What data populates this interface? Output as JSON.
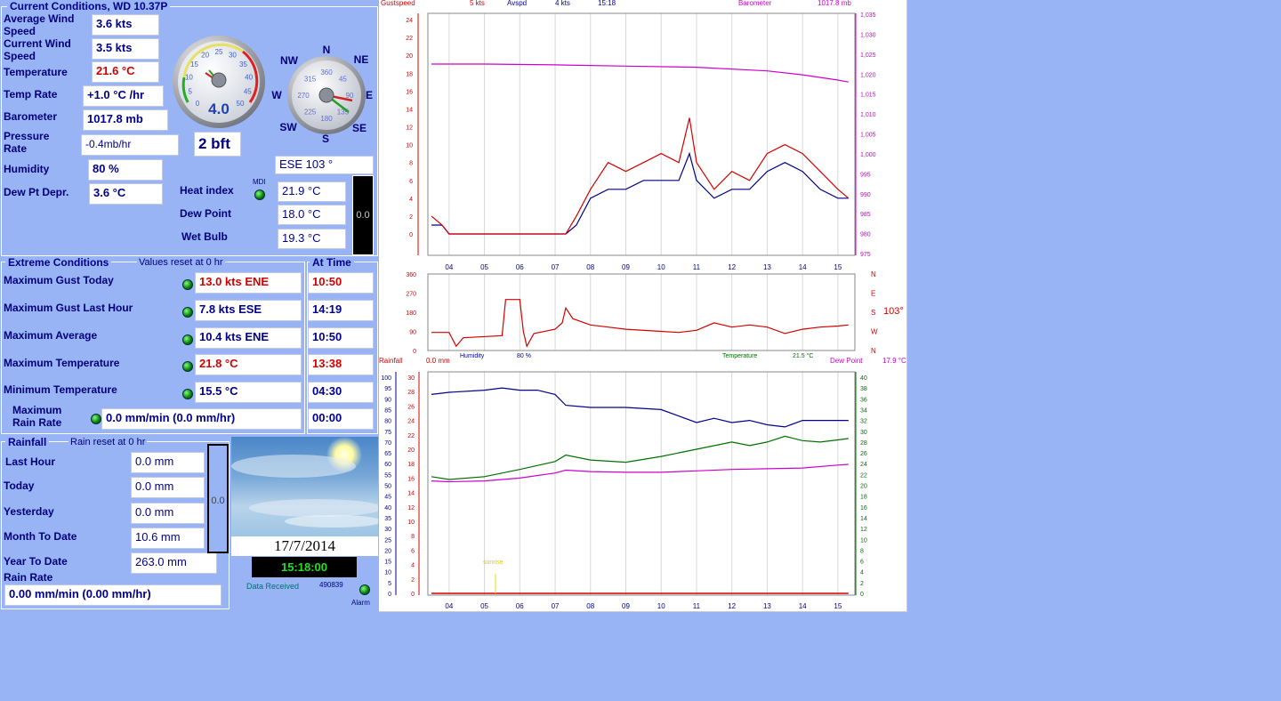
{
  "current": {
    "title": "Current Conditions, WD 10.37P",
    "avg_wind_label": "Average Wind Speed",
    "avg_wind": "3.6 kts",
    "cur_wind_label": "Current Wind Speed",
    "cur_wind": "3.5 kts",
    "temp_label": "Temperature",
    "temp": "21.6 °C",
    "temp_rate_label": "Temp Rate",
    "temp_rate": "+1.0 °C /hr",
    "baro_label": "Barometer",
    "baro": "1017.8 mb",
    "pressure_rate_label": "Pressure Rate",
    "pressure_rate": "-0.4mb/hr",
    "humidity_label": "Humidity",
    "humidity": "80 %",
    "dewdep_label": "Dew Pt Depr.",
    "dewdep": "3.6 °C",
    "gauge_value": "4.0",
    "beaufort": "2 bft",
    "direction": "ESE  103 °",
    "mdi": "MDI",
    "heat_label": "Heat index",
    "heat": "21.9 °C",
    "dew_label": "Dew Point",
    "dew": "18.0 °C",
    "wet_label": "Wet Bulb",
    "wet": "19.3 °C",
    "bar_value": "0.0"
  },
  "gauge": {
    "ticks": [
      "0",
      "5",
      "10",
      "15",
      "20",
      "25",
      "30",
      "35",
      "40",
      "45",
      "50"
    ]
  },
  "compass": {
    "N": "N",
    "NE": "NE",
    "E": "E",
    "SE": "SE",
    "S": "S",
    "SW": "SW",
    "W": "W",
    "NW": "NW",
    "inner": [
      "360",
      "45",
      "90",
      "135",
      "180",
      "225",
      "270",
      "315"
    ]
  },
  "extreme": {
    "title": "Extreme Conditions",
    "reset": "Values reset at 0 hr",
    "at_time": "At Time",
    "rows": [
      {
        "label": "Maximum Gust Today",
        "value": "13.0 kts ENE",
        "time": "10:50",
        "red": true
      },
      {
        "label": "Maximum Gust Last Hour",
        "value": "7.8 kts ESE",
        "time": "14:19",
        "red": false
      },
      {
        "label": "Maximum Average",
        "value": "10.4 kts ENE",
        "time": "10:50",
        "red": false
      },
      {
        "label": "Maximum Temperature",
        "value": "21.8 °C",
        "time": "13:38",
        "red": true
      },
      {
        "label": "Minimum Temperature",
        "value": "15.5 °C",
        "time": "04:30",
        "red": false
      },
      {
        "label": "Maximum Rain Rate",
        "value": "0.0 mm/min (0.0 mm/hr)",
        "time": "00:00",
        "red": false
      }
    ]
  },
  "rain": {
    "title": "Rainfall",
    "reset": "Rain reset at 0 hr",
    "last_hour_label": "Last Hour",
    "last_hour": "0.0 mm",
    "today_label": "Today",
    "today": "0.0 mm",
    "yesterday_label": "Yesterday",
    "yesterday": "0.0 mm",
    "month_label": "Month To Date",
    "month": "10.6 mm",
    "year_label": "Year To Date",
    "year": "263.0 mm",
    "rate_label": "Rain Rate",
    "rate": "0.00 mm/min (0.00 mm/hr)",
    "bar_value": "0.0"
  },
  "status": {
    "date": "17/7/2014",
    "time": "15:18:00",
    "data_received": "Data Received",
    "count": "490839",
    "alarm": "Alarm"
  },
  "graph": {
    "legend_top": {
      "gust_label": "Gustspeed",
      "gust": "5 kts",
      "avg_label": "Avspd",
      "avg": "4 kts",
      "time": "15:18",
      "baro_label": "Barometer",
      "baro": "1017.8 mb"
    },
    "dir_value": "103°",
    "dir_labels": [
      "N",
      "W",
      "S",
      "E",
      "N"
    ],
    "legend_mid": {
      "rain_label": "Rainfall",
      "rain": "0.0 mm",
      "hum_label": "Humidity",
      "hum": "80 %",
      "temp_label": "Temperature",
      "temp": "21.5 °C",
      "dew_label": "Dew Point",
      "dew": "17.9 °C"
    },
    "sunrise": "sunrise"
  },
  "colors": {
    "gust": "#d40000",
    "avg": "#00008b",
    "baro": "#cc00cc",
    "humidity": "#00008b",
    "temperature": "#007000",
    "dew": "#cc00cc",
    "rain": "#d40000"
  },
  "chart_data": [
    {
      "type": "line",
      "x_ticks": [
        "04",
        "05",
        "06",
        "07",
        "08",
        "09",
        "10",
        "11",
        "12",
        "13",
        "14",
        "15"
      ],
      "ylim": [
        0,
        24
      ],
      "y_ticks": [
        "0",
        "2",
        "4",
        "6",
        "8",
        "10",
        "12",
        "14",
        "16",
        "18",
        "20",
        "22",
        "24"
      ],
      "y2lim": [
        975,
        1035
      ],
      "y2_ticks": [
        "975",
        "980",
        "985",
        "990",
        "995",
        "1,000",
        "1,005",
        "1,010",
        "1,015",
        "1,020",
        "1,025",
        "1,030",
        "1,035"
      ],
      "series": [
        {
          "name": "Gustspeed",
          "x": [
            3.5,
            3.8,
            4.0,
            4.2,
            7.0,
            7.3,
            7.6,
            8.0,
            8.5,
            9.0,
            9.5,
            10.0,
            10.5,
            10.8,
            11.0,
            11.5,
            12.0,
            12.5,
            13.0,
            13.5,
            14.0,
            14.5,
            15.0,
            15.3
          ],
          "values": [
            2,
            1,
            0,
            0,
            0,
            0,
            2,
            5,
            8,
            7,
            8,
            9,
            8,
            13,
            8,
            5,
            7,
            6,
            9,
            10,
            9,
            7,
            5,
            4
          ]
        },
        {
          "name": "Avspd",
          "x": [
            3.5,
            3.8,
            4.0,
            4.2,
            7.0,
            7.3,
            7.6,
            8.0,
            8.5,
            9.0,
            9.5,
            10.0,
            10.5,
            10.8,
            11.0,
            11.5,
            12.0,
            12.5,
            13.0,
            13.5,
            14.0,
            14.5,
            15.0,
            15.3
          ],
          "values": [
            1,
            1,
            0,
            0,
            0,
            0,
            1,
            4,
            5,
            5,
            6,
            6,
            6,
            9,
            6,
            4,
            5,
            5,
            7,
            8,
            7,
            5,
            4,
            4
          ]
        },
        {
          "name": "Barometer",
          "x": [
            3.5,
            5.0,
            7.0,
            9.0,
            11.0,
            13.0,
            14.0,
            15.0,
            15.3
          ],
          "values": [
            1022.5,
            1022.5,
            1022.3,
            1022.0,
            1021.7,
            1020.8,
            1019.8,
            1018.5,
            1018.0
          ]
        }
      ]
    },
    {
      "type": "line",
      "x_ticks": [
        "04",
        "05",
        "06",
        "07",
        "08",
        "09",
        "10",
        "11",
        "12",
        "13",
        "14",
        "15"
      ],
      "ylim": [
        0,
        360
      ],
      "y_ticks": [
        "0",
        "90",
        "180",
        "270",
        "360"
      ],
      "series": [
        {
          "name": "Wind direction",
          "x": [
            3.5,
            4.0,
            4.2,
            4.4,
            5.5,
            5.6,
            6.0,
            6.1,
            6.2,
            6.4,
            7.0,
            7.2,
            7.3,
            7.5,
            8.0,
            8.5,
            9.0,
            10.0,
            10.5,
            11.0,
            11.5,
            12.0,
            12.5,
            13.0,
            13.5,
            14.0,
            14.5,
            15.0,
            15.3
          ],
          "values": [
            85,
            85,
            20,
            60,
            70,
            240,
            240,
            90,
            20,
            80,
            100,
            130,
            200,
            150,
            120,
            110,
            100,
            90,
            85,
            95,
            130,
            110,
            120,
            110,
            80,
            100,
            110,
            115,
            120
          ]
        }
      ]
    },
    {
      "type": "line",
      "x_ticks": [
        "04",
        "05",
        "06",
        "07",
        "08",
        "09",
        "10",
        "11",
        "12",
        "13",
        "14",
        "15"
      ],
      "ylim": [
        0,
        100
      ],
      "y_ticks": [
        "0",
        "5",
        "10",
        "15",
        "20",
        "25",
        "30",
        "35",
        "40",
        "45",
        "50",
        "55",
        "60",
        "65",
        "70",
        "75",
        "80",
        "85",
        "90",
        "95",
        "100"
      ],
      "ylim_temp": [
        0,
        30
      ],
      "y_temp_ticks": [
        "0",
        "2",
        "4",
        "6",
        "8",
        "10",
        "12",
        "14",
        "16",
        "18",
        "20",
        "22",
        "24",
        "26",
        "28",
        "30"
      ],
      "y2lim": [
        0,
        40
      ],
      "y2_ticks": [
        "0",
        "2",
        "4",
        "6",
        "8",
        "10",
        "12",
        "14",
        "16",
        "18",
        "20",
        "22",
        "24",
        "26",
        "28",
        "30",
        "32",
        "34",
        "36",
        "38",
        "40"
      ],
      "series": [
        {
          "name": "Humidity",
          "x": [
            3.5,
            4.0,
            5.0,
            5.5,
            6.0,
            6.5,
            7.0,
            7.3,
            8.0,
            9.0,
            10.0,
            10.5,
            11.0,
            11.5,
            12.0,
            12.5,
            13.0,
            13.5,
            14.0,
            14.5,
            15.0,
            15.3
          ],
          "values": [
            92,
            93,
            94,
            95,
            94,
            94,
            92,
            87,
            86,
            86,
            85,
            82,
            79,
            81,
            79,
            80,
            78,
            77,
            80,
            80,
            80,
            80
          ]
        },
        {
          "name": "Temperature",
          "x": [
            3.5,
            4.0,
            5.0,
            6.0,
            7.0,
            7.3,
            8.0,
            9.0,
            10.0,
            11.0,
            12.0,
            12.5,
            13.0,
            13.5,
            14.0,
            14.5,
            15.0,
            15.3
          ],
          "values": [
            16.2,
            15.8,
            16.2,
            17.2,
            18.3,
            19.2,
            18.5,
            18.2,
            19.0,
            20.0,
            21.0,
            20.5,
            21.0,
            21.8,
            21.2,
            21.0,
            21.3,
            21.5
          ]
        },
        {
          "name": "Dew Point",
          "x": [
            3.5,
            4.0,
            5.0,
            6.0,
            7.0,
            7.3,
            8.0,
            9.0,
            10.0,
            11.0,
            12.0,
            13.0,
            14.0,
            15.0,
            15.3
          ],
          "values": [
            15.6,
            15.5,
            15.6,
            16.0,
            16.7,
            17.1,
            16.9,
            16.8,
            16.8,
            17.0,
            17.2,
            17.3,
            17.4,
            17.8,
            17.9
          ]
        },
        {
          "name": "Rainfall",
          "x": [
            3.5,
            15.3
          ],
          "values": [
            0,
            0
          ]
        }
      ]
    }
  ]
}
